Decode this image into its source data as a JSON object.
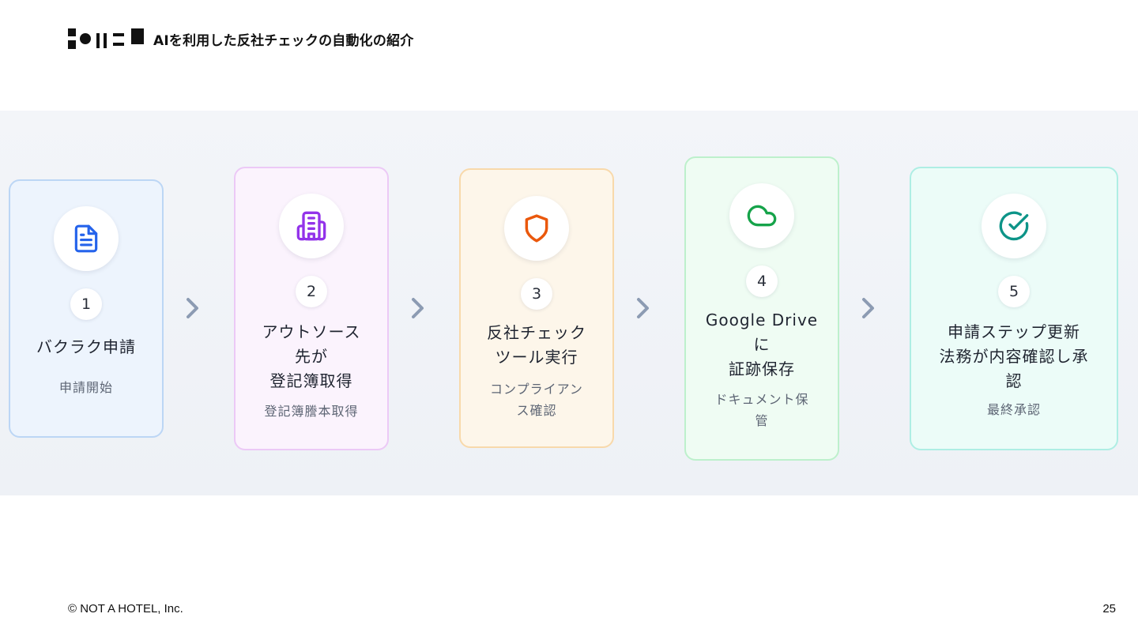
{
  "header": {
    "title": "AIを利用した反社チェックの自動化の紹介",
    "logo_icon": "not-a-hotel-logo-icon"
  },
  "steps": [
    {
      "number": "1",
      "title": "バクラク申請",
      "subtitle": "申請開始",
      "icon": "document-icon",
      "color": "#2563eb",
      "border": "#bcd6f5",
      "fill": "#edf4fd"
    },
    {
      "number": "2",
      "title": "アウトソース\n先が\n登記簿取得",
      "subtitle": "登記簿謄本取得",
      "icon": "building-icon",
      "color": "#9333ea",
      "border": "#ecc9f6",
      "fill": "#fbf3fd"
    },
    {
      "number": "3",
      "title": "反社チェック\nツール実行",
      "subtitle": "コンプライアン\nス確認",
      "icon": "shield-icon",
      "color": "#ea580c",
      "border": "#f8d9ab",
      "fill": "#fdf6ea"
    },
    {
      "number": "4",
      "title": "Google Drive\nに\n証跡保存",
      "subtitle": "ドキュメント保\n管",
      "icon": "cloud-icon",
      "color": "#16a34a",
      "border": "#bdf0cc",
      "fill": "#effcf3"
    },
    {
      "number": "5",
      "title": "申請ステップ更新\n法務が内容確認し承\n認",
      "subtitle": "最終承認",
      "icon": "check-circle-icon",
      "color": "#0d9488",
      "border": "#aeeee4",
      "fill": "#ecfcf8"
    }
  ],
  "arrow_icon": "chevron-right-icon",
  "footer": {
    "copyright": "© NOT A HOTEL, Inc.",
    "page_number": "25"
  }
}
